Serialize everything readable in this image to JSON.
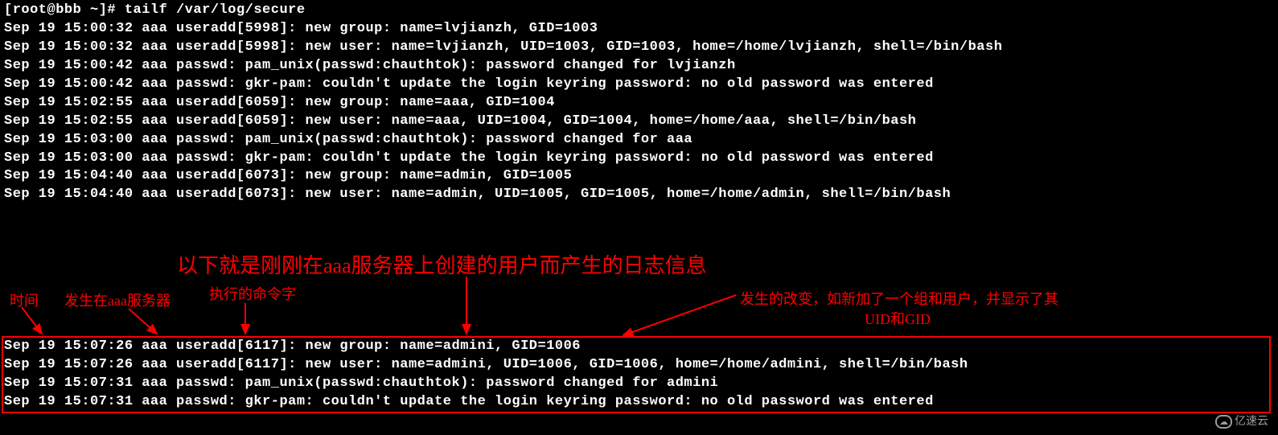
{
  "prompt": "[root@bbb ~]# tailf /var/log/secure",
  "log_lines_top": [
    "Sep 19 15:00:32 aaa useradd[5998]: new group: name=lvjianzh, GID=1003",
    "Sep 19 15:00:32 aaa useradd[5998]: new user: name=lvjianzh, UID=1003, GID=1003, home=/home/lvjianzh, shell=/bin/bash",
    "Sep 19 15:00:42 aaa passwd: pam_unix(passwd:chauthtok): password changed for lvjianzh",
    "Sep 19 15:00:42 aaa passwd: gkr-pam: couldn't update the login keyring password: no old password was entered",
    "Sep 19 15:02:55 aaa useradd[6059]: new group: name=aaa, GID=1004",
    "Sep 19 15:02:55 aaa useradd[6059]: new user: name=aaa, UID=1004, GID=1004, home=/home/aaa, shell=/bin/bash",
    "Sep 19 15:03:00 aaa passwd: pam_unix(passwd:chauthtok): password changed for aaa",
    "Sep 19 15:03:00 aaa passwd: gkr-pam: couldn't update the login keyring password: no old password was entered",
    "Sep 19 15:04:40 aaa useradd[6073]: new group: name=admin, GID=1005",
    "Sep 19 15:04:40 aaa useradd[6073]: new user: name=admin, UID=1005, GID=1005, home=/home/admin, shell=/bin/bash"
  ],
  "log_lines_boxed": [
    "Sep 19 15:07:26 aaa useradd[6117]: new group: name=admini, GID=1006",
    "Sep 19 15:07:26 aaa useradd[6117]: new user: name=admini, UID=1006, GID=1006, home=/home/admini, shell=/bin/bash",
    "Sep 19 15:07:31 aaa passwd: pam_unix(passwd:chauthtok): password changed for admini",
    "Sep 19 15:07:31 aaa passwd: gkr-pam: couldn't update the login keyring password: no old password was entered"
  ],
  "annotations": {
    "main": "以下就是刚刚在aaa服务器上创建的用户而产生的日志信息",
    "time": "时间",
    "server": "发生在aaa服务器",
    "command": "执行的命令字",
    "change_line1": "发生的改变，如新加了一个组和用户，并显示了其",
    "change_line2": "UID和GID"
  },
  "watermark": "亿速云"
}
